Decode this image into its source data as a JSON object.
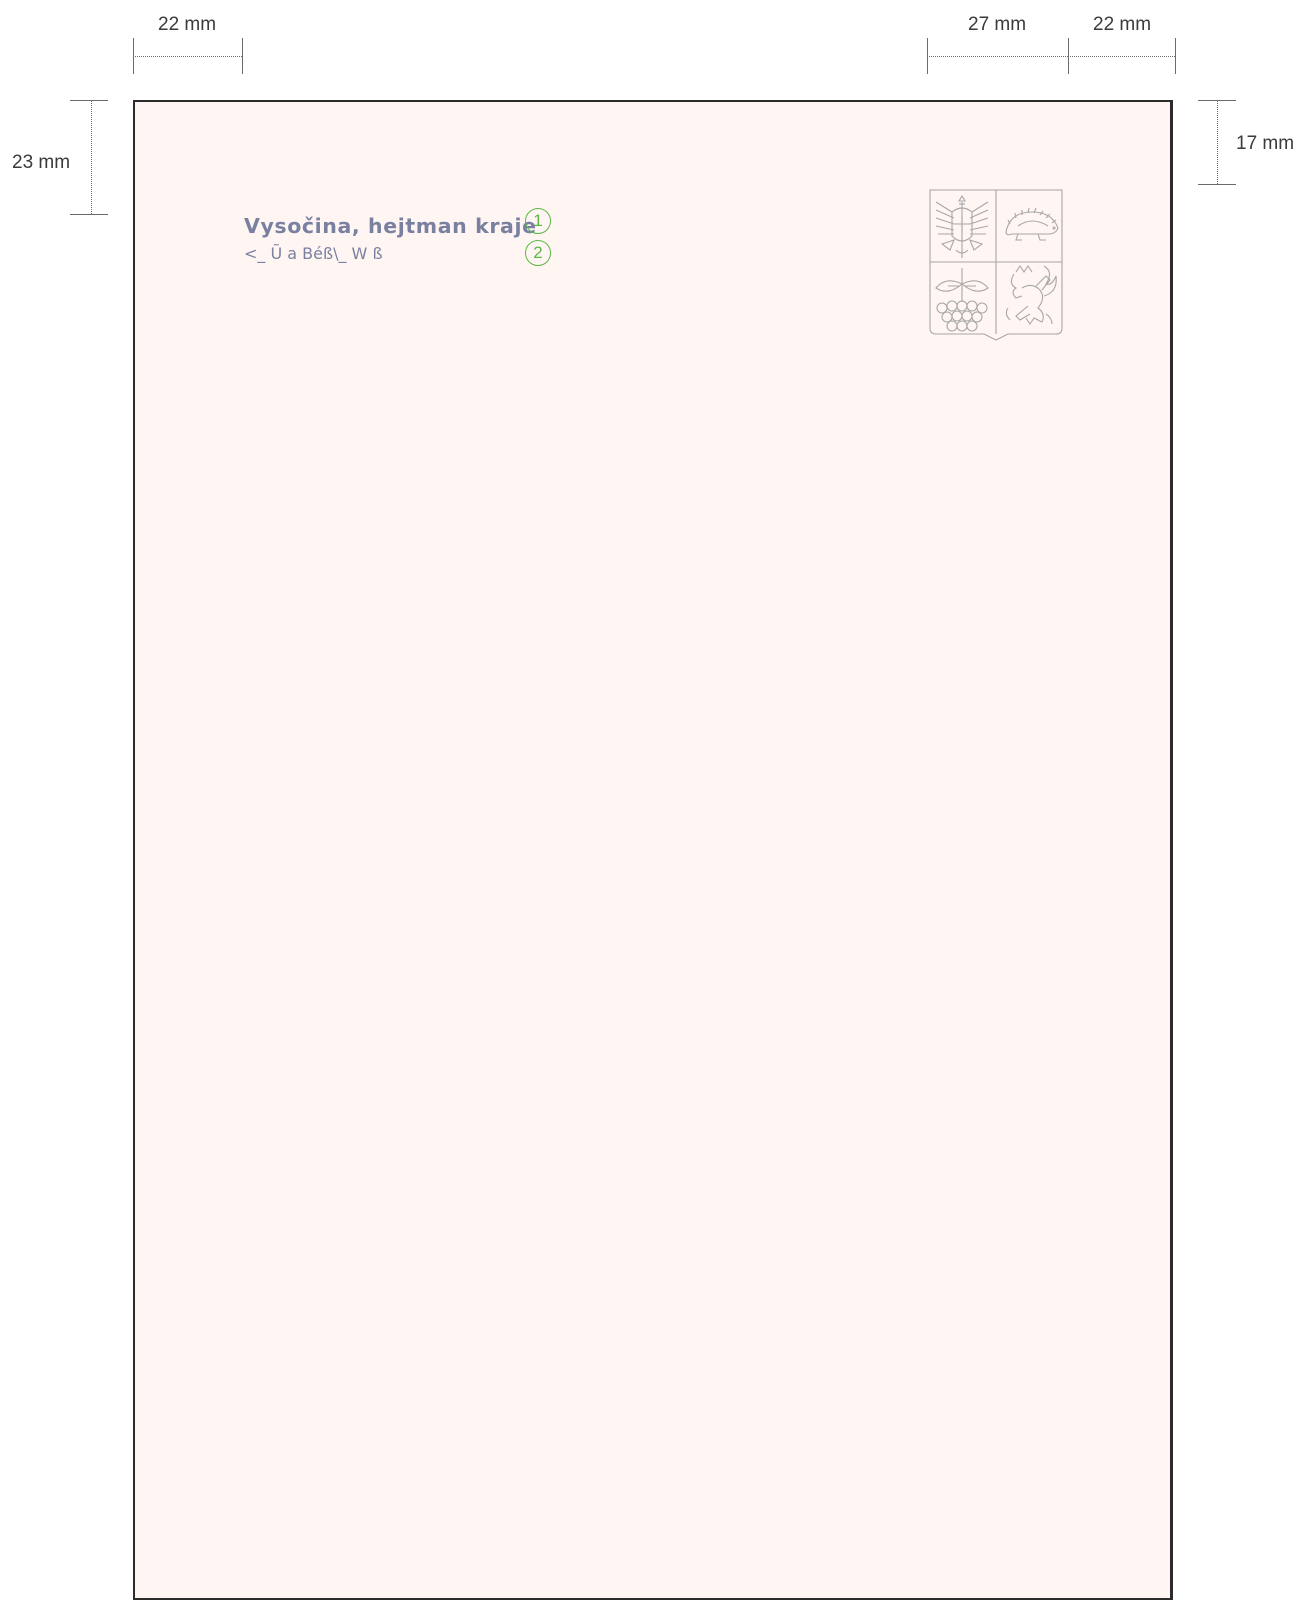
{
  "dimensions": {
    "left_margin": "22 mm",
    "crest_offset": "27 mm",
    "right_margin": "22 mm",
    "top_margin": "23 mm",
    "crest_top": "17 mm"
  },
  "letterhead": {
    "sender_name": "Vysočina, hejtman kraje",
    "sender_subtitle": "<_ Ũ a Béß\\_ W ß",
    "markers": [
      "1",
      "2"
    ]
  },
  "crest": {
    "icon": "coat-of-arms-icon",
    "quadrants": [
      "eagle-icon",
      "hedgehog-icon",
      "rowan-berries-icon",
      "lion-icon"
    ]
  },
  "colors": {
    "page_background": "#fff6f3",
    "text": "#7a80a0",
    "marker": "#5cb845",
    "crest_line": "#a7a7a7"
  }
}
